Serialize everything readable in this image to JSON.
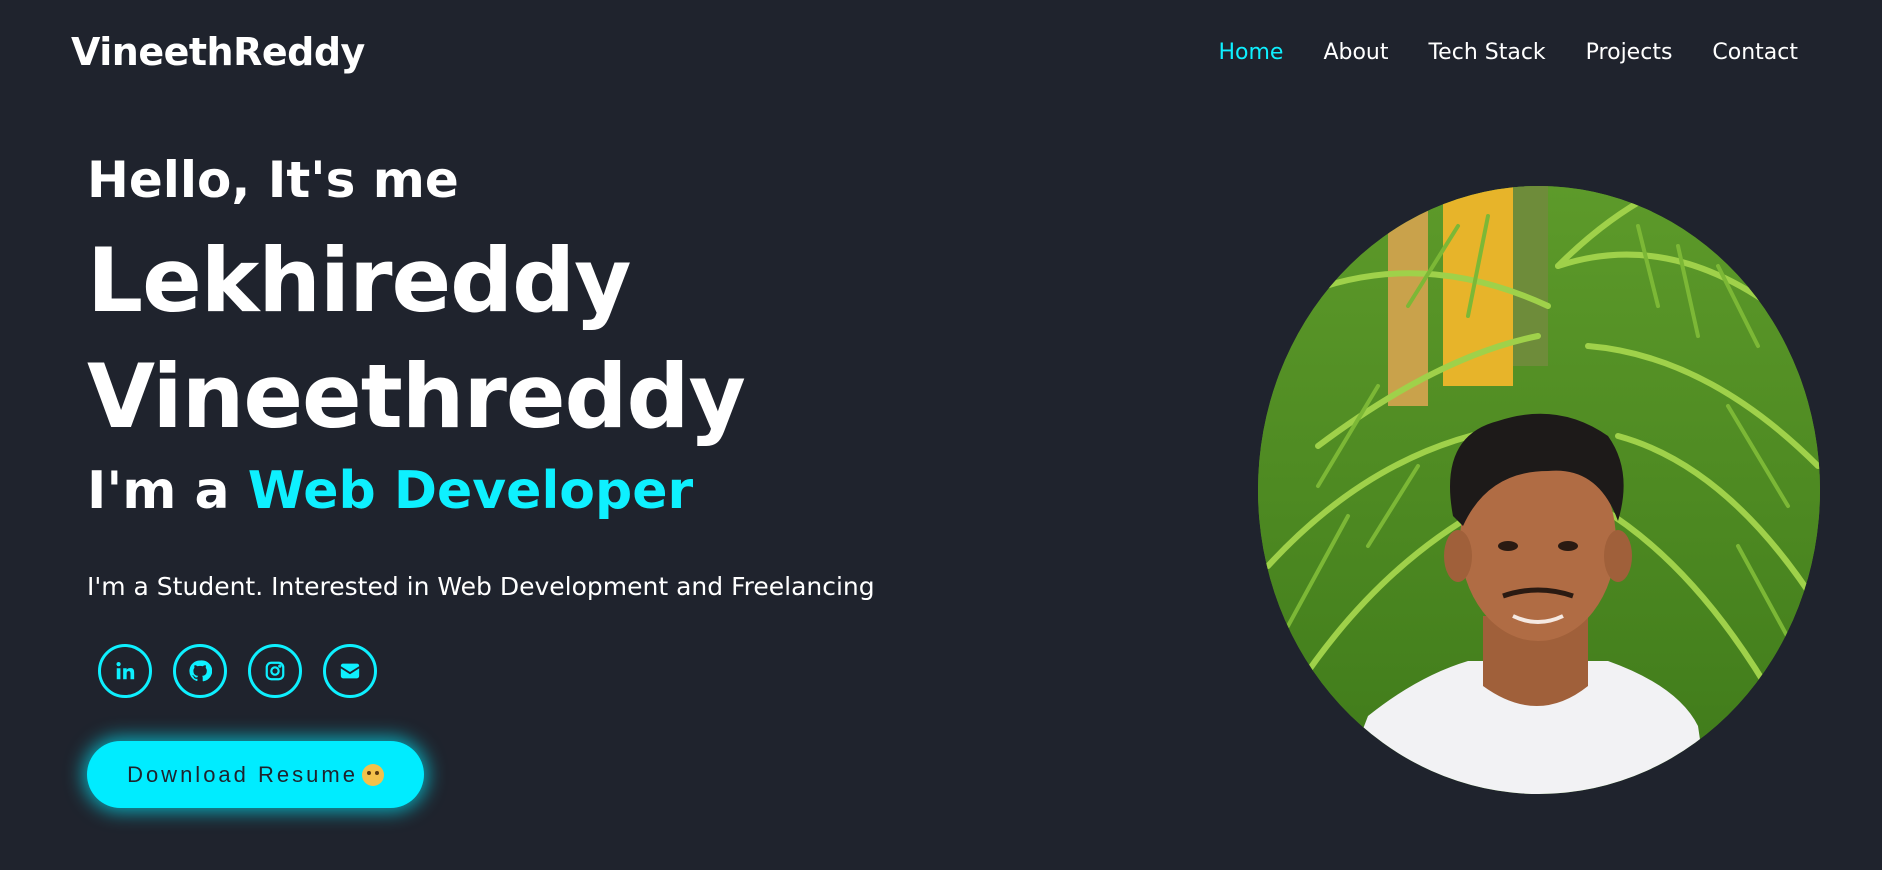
{
  "header": {
    "logo": "VineethReddy",
    "nav": [
      {
        "label": "Home",
        "active": true
      },
      {
        "label": "About",
        "active": false
      },
      {
        "label": "Tech Stack",
        "active": false
      },
      {
        "label": "Projects",
        "active": false
      },
      {
        "label": "Contact",
        "active": false
      }
    ]
  },
  "hero": {
    "greeting": "Hello, It's me",
    "name_line1": "Lekhireddy",
    "name_line2": "Vineethreddy",
    "role_prefix": "I'm a ",
    "role_highlight": "Web Developer",
    "bio": "I'm a Student. Interested in Web Development and Freelancing",
    "socials": [
      {
        "icon": "linkedin-icon"
      },
      {
        "icon": "github-icon"
      },
      {
        "icon": "instagram-icon"
      },
      {
        "icon": "email-icon"
      }
    ],
    "resume_button": "Download Resume"
  },
  "colors": {
    "background": "#1f232d",
    "accent": "#0ef0ff",
    "text": "#ffffff"
  }
}
